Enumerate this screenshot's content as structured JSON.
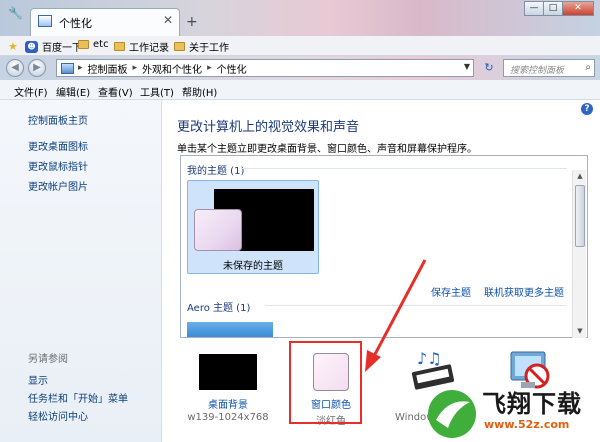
{
  "window": {
    "tab_title": "个性化",
    "tab_close_glyph": "✕",
    "new_tab_glyph": "+",
    "buttons": [
      "—",
      "□",
      "✕"
    ]
  },
  "favorites": [
    {
      "label": "百度一下",
      "icon": "baidu-paw-icon"
    },
    {
      "label": "etc",
      "icon": "folder-icon"
    },
    {
      "label": "工作记录",
      "icon": "folder-icon"
    },
    {
      "label": "关于工作",
      "icon": "folder-icon"
    }
  ],
  "address": {
    "crumbs": [
      "控制面板",
      "外观和个性化",
      "个性化"
    ],
    "separator": "▸",
    "search_placeholder": "搜索控制面板"
  },
  "menu": [
    "文件(F)",
    "编辑(E)",
    "查看(V)",
    "工具(T)",
    "帮助(H)"
  ],
  "left_pane": {
    "home": "控制面板主页",
    "links": [
      "更改桌面图标",
      "更改鼠标指针",
      "更改帐户图片"
    ],
    "see_also_title": "另请参阅",
    "see_also": [
      "显示",
      "任务栏和「开始」菜单",
      "轻松访问中心"
    ]
  },
  "main": {
    "heading": "更改计算机上的视觉效果和声音",
    "description": "单击某个主题立即更改桌面背景、窗口颜色、声音和屏幕保护程序。",
    "my_themes_label": "我的主题 (1)",
    "unsaved_theme": "未保存的主题",
    "save_theme": "保存主题",
    "get_more_themes": "联机获取更多主题",
    "aero_label": "Aero 主题 (1)"
  },
  "options": {
    "desktop_bg": {
      "label": "桌面背景",
      "sub": "w139-1024x768"
    },
    "window_color": {
      "label": "窗口颜色",
      "sub": "淡红色"
    },
    "sounds_sub": "Windows"
  },
  "watermark": {
    "text": "飞翔下载",
    "url": "www.52z.com"
  },
  "colors": {
    "highlight": "#e5302a",
    "link": "#0b52b0",
    "heading": "#1d3b79"
  }
}
